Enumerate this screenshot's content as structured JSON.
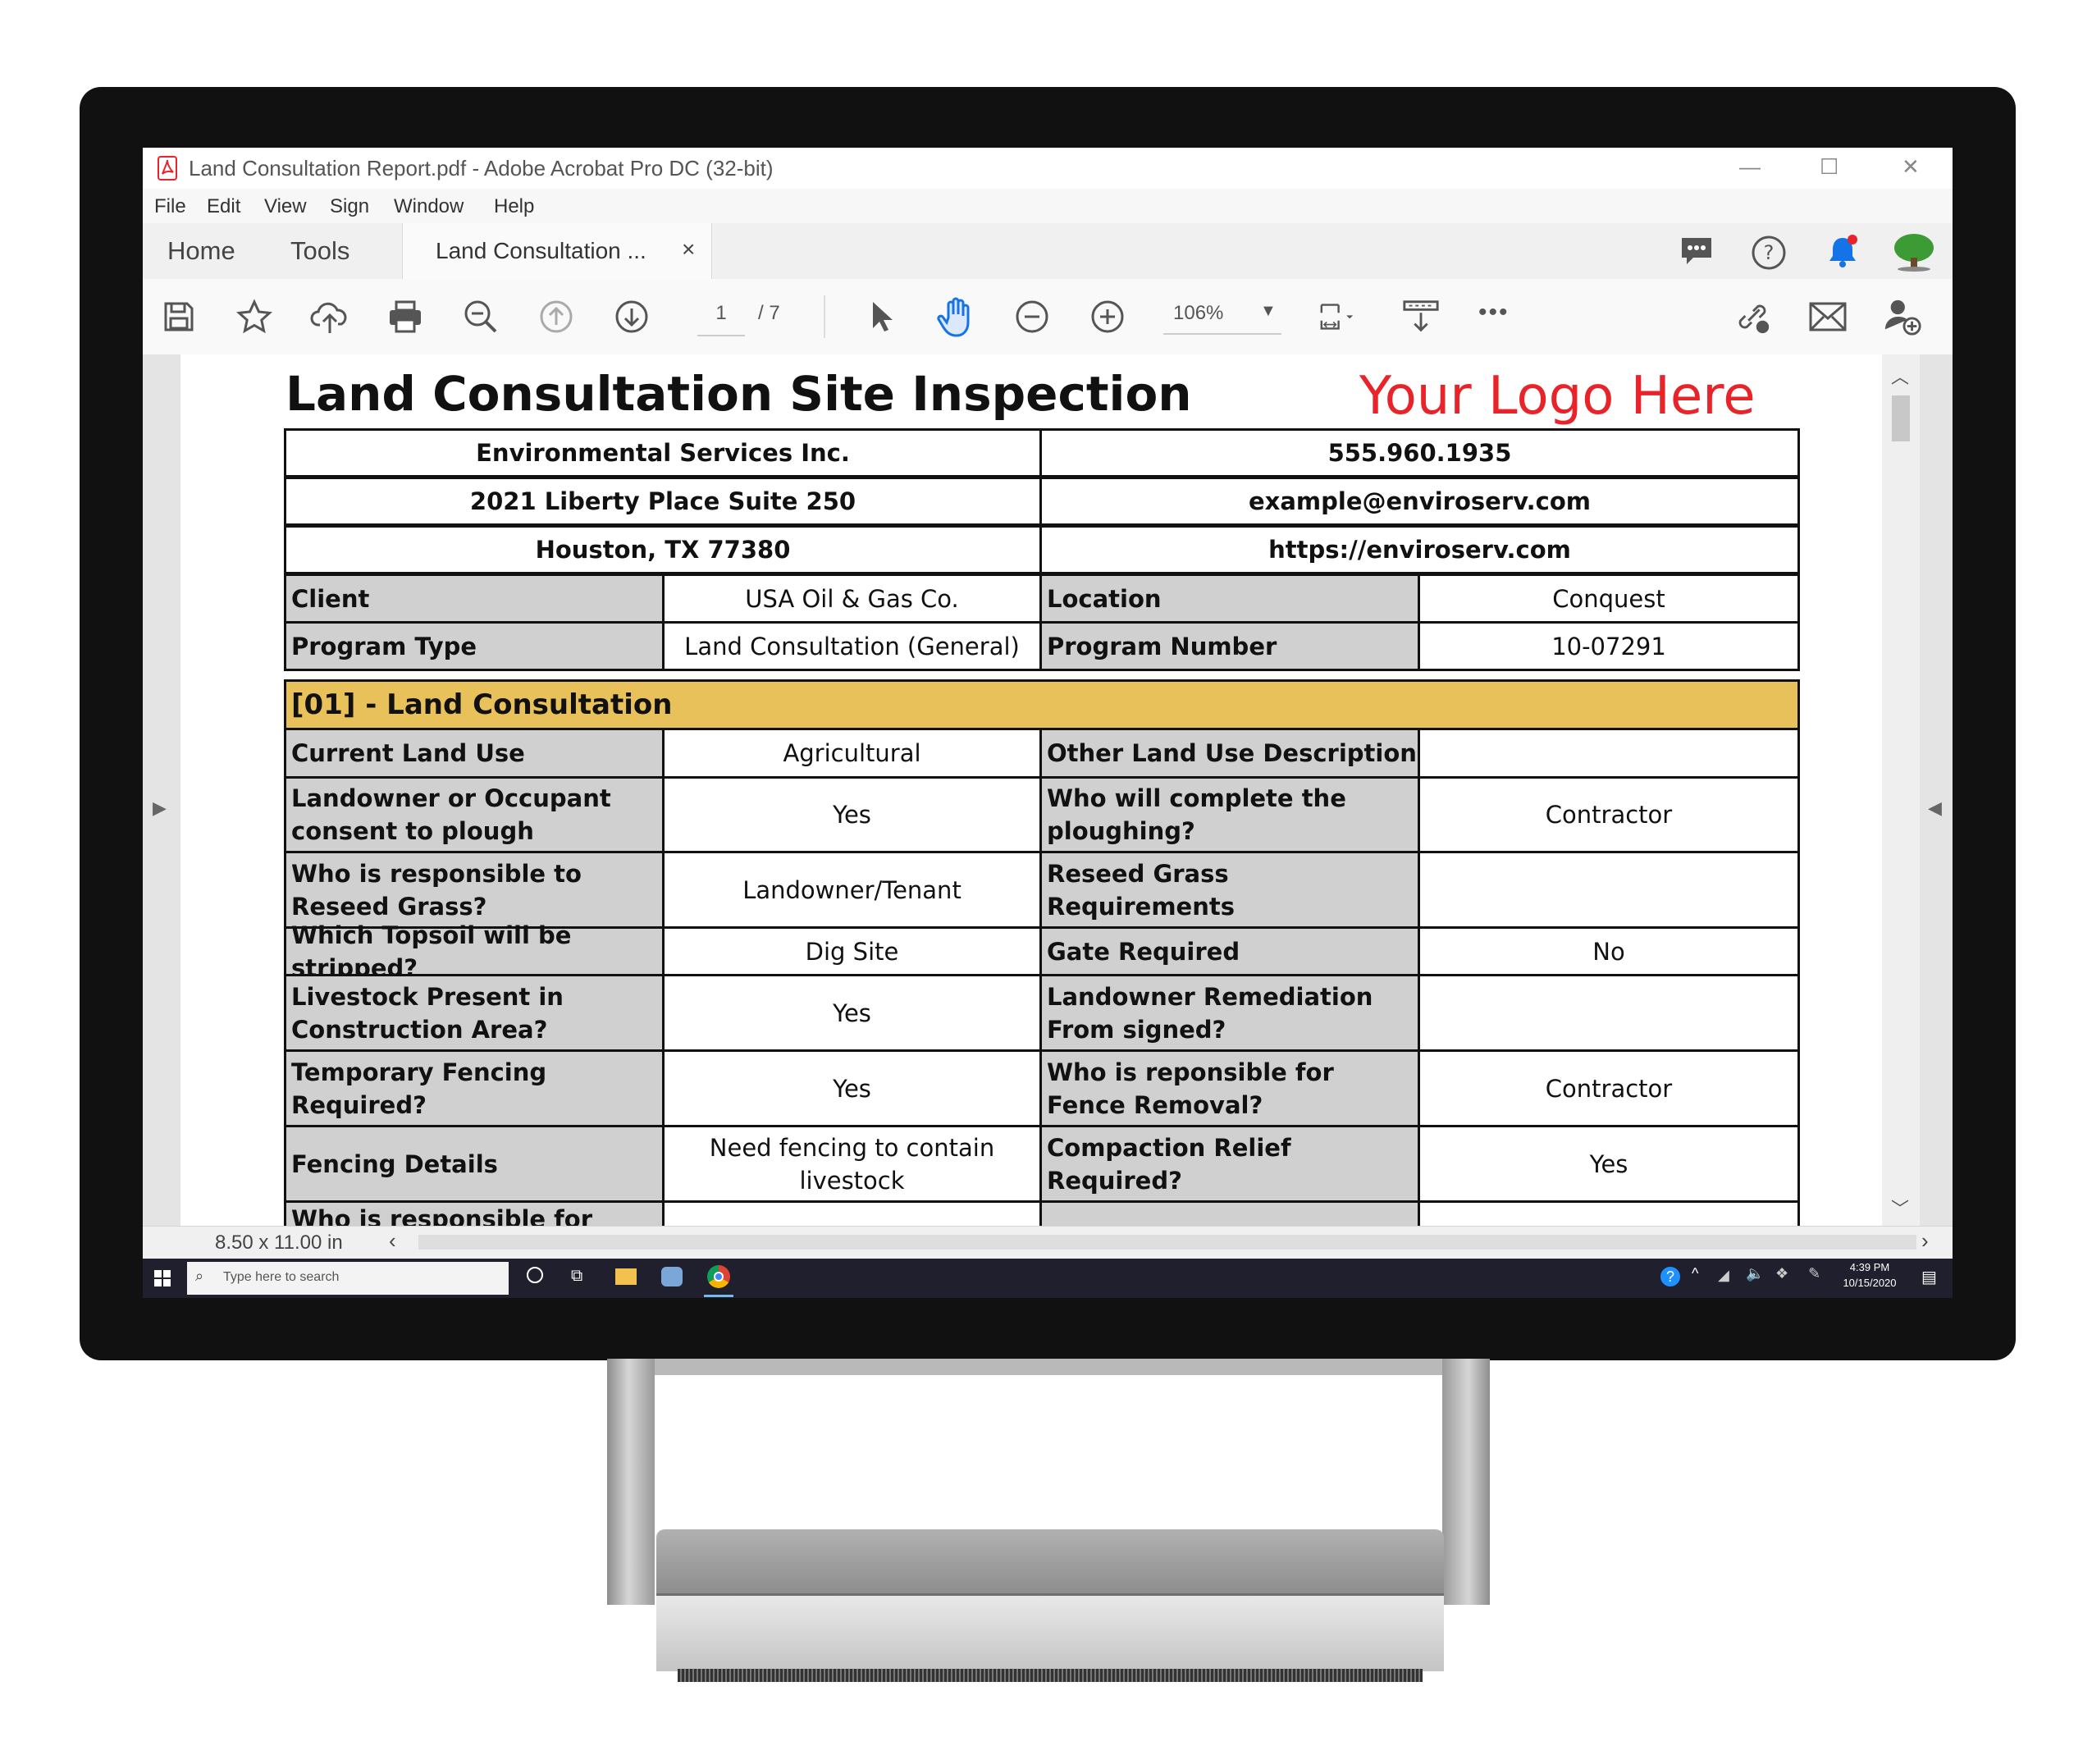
{
  "window": {
    "title": "Land Consultation Report.pdf - Adobe Acrobat Pro DC (32-bit)",
    "controls": [
      "—",
      "☐",
      "✕"
    ]
  },
  "menu": [
    "File",
    "Edit",
    "View",
    "Sign",
    "Window",
    "Help"
  ],
  "tabs": {
    "home": "Home",
    "tools": "Tools",
    "document": "Land Consultation ...",
    "close": "×"
  },
  "toolbar": {
    "page_current": "1",
    "page_total": "/ 7",
    "zoom": "106%"
  },
  "report": {
    "title": "Land Consultation Site Inspection",
    "logo": "Your Logo Here",
    "company": {
      "name": "Environmental Services Inc.",
      "phone": "555.960.1935",
      "address": "2021 Liberty Place Suite 250",
      "email": "example@enviroserv.com",
      "city": "Houston, TX 77380",
      "website": "https://enviroserv.com"
    },
    "info": {
      "client_label": "Client",
      "client": "USA Oil & Gas Co.",
      "location_label": "Location",
      "location": "Conquest",
      "program_type_label": "Program Type",
      "program_type": "Land Consultation (General)",
      "program_number_label": "Program Number",
      "program_number": "10-07291"
    },
    "section": "[01] - Land Consultation",
    "rows": [
      [
        "Current Land Use",
        "Agricultural",
        "Other Land Use Description",
        ""
      ],
      [
        "Landowner or Occupant consent to plough",
        "Yes",
        "Who will complete the ploughing?",
        "Contractor"
      ],
      [
        "Who is responsible to Reseed Grass?",
        "Landowner/Tenant",
        "Reseed Grass Requirements",
        ""
      ],
      [
        "Which Topsoil will be stripped?",
        "Dig Site",
        "Gate Required",
        "No"
      ],
      [
        "Livestock Present in Construction Area?",
        "Yes",
        "Landowner Remediation From signed?",
        ""
      ],
      [
        "Temporary Fencing Required?",
        "Yes",
        "Who is reponsible for Fence Removal?",
        "Contractor"
      ],
      [
        "Fencing Details",
        "Need fencing to contain livestock",
        "Compaction Relief Required?",
        "Yes"
      ],
      [
        "Who is responsible for",
        "",
        "",
        ""
      ]
    ]
  },
  "status": {
    "page_size": "8.50 x 11.00 in"
  },
  "taskbar": {
    "search_placeholder": "Type here to search",
    "time": "4:39 PM",
    "date": "10/15/2020"
  },
  "colors": {
    "logo_red": "#e8242a",
    "section_gold": "#e9c15a",
    "label_gray": "#d0d0d0",
    "hand_blue": "#1473e6"
  }
}
